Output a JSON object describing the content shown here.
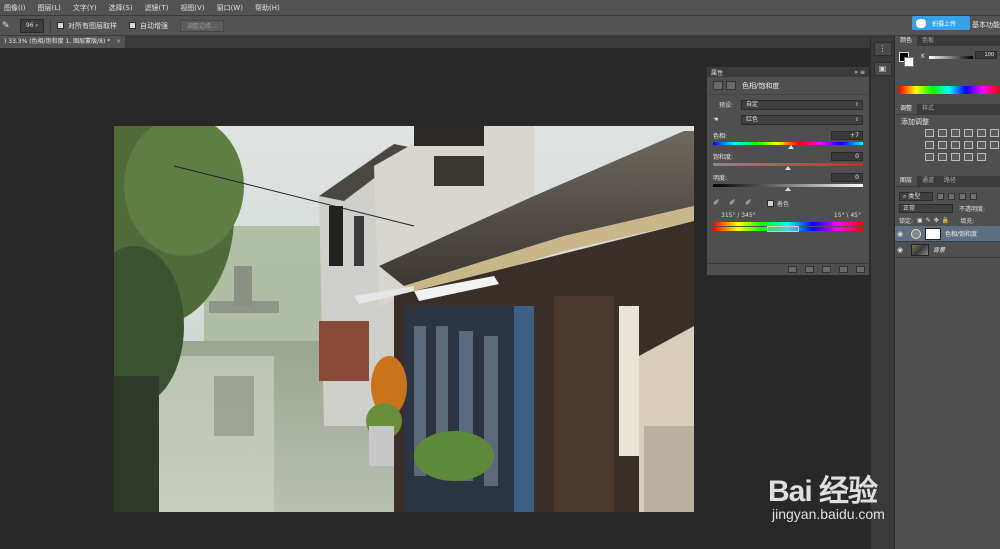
{
  "menu": {
    "items": [
      "图像(I)",
      "图层(L)",
      "文字(Y)",
      "选择(S)",
      "滤镜(T)",
      "视图(V)",
      "窗口(W)",
      "帮助(H)"
    ]
  },
  "options_bar": {
    "brush_size": "96",
    "sample_all_layers": "对所有图层取样",
    "auto_enhance": "自动增强",
    "refine_edge": "调整边缘...",
    "upload_button": "拍摄上传",
    "workspace": "基本功能"
  },
  "document_tab": {
    "title": ") 33.3% (色相/饱和度 1, 图层蒙版/8) *",
    "close": "×"
  },
  "properties": {
    "panel_tab": "属性",
    "title": "色相/饱和度",
    "preset_label": "预设:",
    "preset_value": "自定",
    "channel_value": "红色",
    "hue_label": "色相:",
    "hue_value": "+7",
    "hue": 7,
    "saturation_label": "饱和度:",
    "saturation_value": "0",
    "saturation": 0,
    "lightness_label": "明度:",
    "lightness_value": "0",
    "lightness": 0,
    "colorize_label": "着色",
    "range_left": "315° / 345°",
    "range_right": "15° \\ 45°"
  },
  "right_panels": {
    "color_tab": "颜色",
    "swatches_tab": "色板",
    "k_label": "K",
    "k_value": "100",
    "k_level": 1.0,
    "adjust_tab": "调整",
    "styles_tab": "样式",
    "add_adjustment": "添加调整",
    "layers_tab": "图层",
    "channels_tab": "通道",
    "paths_tab": "路径",
    "kind_filter": "类型",
    "blend_mode": "正常",
    "opacity_label": "不透明度:",
    "lock_label": "锁定:",
    "fill_label": "填充:",
    "layers": [
      {
        "name": "色相/饱和度"
      },
      {
        "name": "背景"
      }
    ]
  },
  "watermark": {
    "logo": "Bai 经验",
    "url": "jingyan.baidu.com"
  },
  "colors": {
    "ui_bg": "#535353",
    "panel_bg": "#4f4f4f",
    "canvas_bg": "#282828",
    "accent": "#38a1e8"
  }
}
